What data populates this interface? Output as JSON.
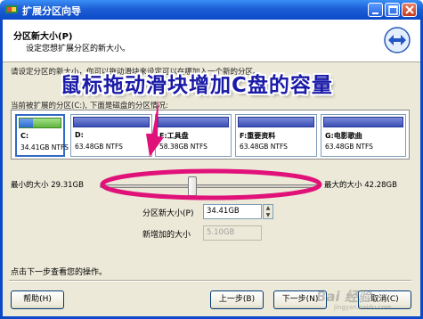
{
  "window": {
    "title": "扩展分区向导"
  },
  "header": {
    "title": "分区新大小(P)",
    "subtitle": "设定您想扩展分区的新大小。"
  },
  "instructions": {
    "line1": "请设定分区的新大小，你可以拖动滑块来设定可以在哪加入一个新的分区。",
    "line2": "当前被扩展的分区(C:), 下面是磁盘的分区情况:"
  },
  "overlay": {
    "text": "鼠标拖动滑块增加C盘的容量",
    "color": "#1a1aa8",
    "ellipse_color": "#e0127a"
  },
  "partitions": [
    {
      "name": "C:",
      "size": "34.41GB NTFS",
      "usage": 0.32,
      "selected": true
    },
    {
      "name": "D:",
      "size": "63.48GB NTFS"
    },
    {
      "name": "E:工具盘",
      "size": "58.38GB NTFS"
    },
    {
      "name": "F:重要资料",
      "size": "63.48GB NTFS"
    },
    {
      "name": "G:电影歌曲",
      "size": "63.48GB NTFS"
    }
  ],
  "slider": {
    "min_label": "最小的大小 29.31GB",
    "max_label": "最大的大小 42.28GB"
  },
  "new_size": {
    "label": "分区新大小(P)",
    "value": "34.41GB"
  },
  "added_size": {
    "label": "新增加的大小",
    "value": "5.10GB"
  },
  "hint": "点击下一步查看您的操作。",
  "buttons": {
    "help": "帮助(H)",
    "back": "上一步(B)",
    "next": "下一步(N)",
    "cancel": "取消(C)"
  },
  "watermark": {
    "text": "Bai 经验",
    "sub": "jingyan.baidu.com"
  }
}
